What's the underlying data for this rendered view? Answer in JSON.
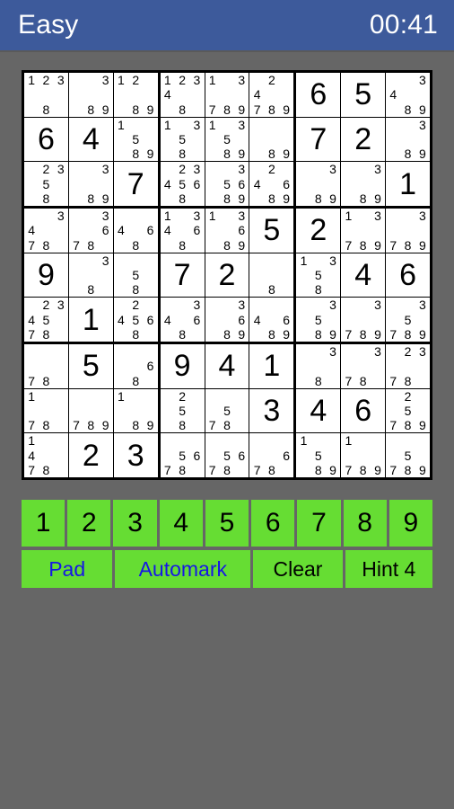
{
  "header": {
    "difficulty": "Easy",
    "timer": "00:41",
    "background_color": "#3D5A9B",
    "text_color": "#FFFFFF"
  },
  "theme": {
    "page_background": "#666666",
    "button_green": "#66DD33",
    "button_text_black": "#000000",
    "button_text_blue": "#1616E6",
    "grid_line": "#000000",
    "cell_background": "#FFFFFF"
  },
  "board": {
    "size": 9,
    "cells": [
      [
        {
          "value": null,
          "candidates": [
            1,
            2,
            3,
            8
          ]
        },
        {
          "value": null,
          "candidates": [
            3,
            8,
            9
          ]
        },
        {
          "value": null,
          "candidates": [
            1,
            2,
            8,
            9
          ]
        },
        {
          "value": null,
          "candidates": [
            1,
            2,
            3,
            4,
            8
          ]
        },
        {
          "value": null,
          "candidates": [
            1,
            3,
            7,
            8,
            9
          ]
        },
        {
          "value": null,
          "candidates": [
            2,
            4,
            7,
            8,
            9
          ]
        },
        {
          "value": 6,
          "candidates": []
        },
        {
          "value": 5,
          "candidates": []
        },
        {
          "value": null,
          "candidates": [
            3,
            4,
            8,
            9
          ]
        }
      ],
      [
        {
          "value": 6,
          "candidates": []
        },
        {
          "value": 4,
          "candidates": []
        },
        {
          "value": null,
          "candidates": [
            1,
            5,
            8,
            9
          ]
        },
        {
          "value": null,
          "candidates": [
            1,
            3,
            5,
            8
          ]
        },
        {
          "value": null,
          "candidates": [
            1,
            3,
            5,
            8,
            9
          ]
        },
        {
          "value": null,
          "candidates": [
            8,
            9
          ]
        },
        {
          "value": 7,
          "candidates": []
        },
        {
          "value": 2,
          "candidates": []
        },
        {
          "value": null,
          "candidates": [
            3,
            8,
            9
          ]
        }
      ],
      [
        {
          "value": null,
          "candidates": [
            2,
            3,
            5,
            8
          ]
        },
        {
          "value": null,
          "candidates": [
            3,
            8,
            9
          ]
        },
        {
          "value": 7,
          "candidates": []
        },
        {
          "value": null,
          "candidates": [
            2,
            3,
            4,
            5,
            6,
            8
          ]
        },
        {
          "value": null,
          "candidates": [
            3,
            5,
            6,
            8,
            9
          ]
        },
        {
          "value": null,
          "candidates": [
            2,
            4,
            6,
            8,
            9
          ]
        },
        {
          "value": null,
          "candidates": [
            3,
            8,
            9
          ]
        },
        {
          "value": null,
          "candidates": [
            3,
            8,
            9
          ]
        },
        {
          "value": 1,
          "candidates": []
        }
      ],
      [
        {
          "value": null,
          "candidates": [
            3,
            4,
            7,
            8
          ]
        },
        {
          "value": null,
          "candidates": [
            3,
            6,
            7,
            8
          ]
        },
        {
          "value": null,
          "candidates": [
            4,
            6,
            8
          ]
        },
        {
          "value": null,
          "candidates": [
            1,
            3,
            4,
            6,
            8
          ]
        },
        {
          "value": null,
          "candidates": [
            1,
            3,
            6,
            8,
            9
          ]
        },
        {
          "value": 5,
          "candidates": []
        },
        {
          "value": 2,
          "candidates": []
        },
        {
          "value": null,
          "candidates": [
            1,
            3,
            7,
            8,
            9
          ]
        },
        {
          "value": null,
          "candidates": [
            3,
            7,
            8,
            9
          ]
        }
      ],
      [
        {
          "value": 9,
          "candidates": []
        },
        {
          "value": null,
          "candidates": [
            3,
            8
          ]
        },
        {
          "value": null,
          "candidates": [
            5,
            8
          ]
        },
        {
          "value": 7,
          "candidates": []
        },
        {
          "value": 2,
          "candidates": []
        },
        {
          "value": null,
          "candidates": [
            8
          ]
        },
        {
          "value": null,
          "candidates": [
            1,
            3,
            5,
            8
          ]
        },
        {
          "value": 4,
          "candidates": []
        },
        {
          "value": 6,
          "candidates": []
        }
      ],
      [
        {
          "value": null,
          "candidates": [
            2,
            3,
            4,
            5,
            7,
            8
          ]
        },
        {
          "value": 1,
          "candidates": []
        },
        {
          "value": null,
          "candidates": [
            2,
            4,
            5,
            6,
            8
          ]
        },
        {
          "value": null,
          "candidates": [
            3,
            4,
            6,
            8
          ]
        },
        {
          "value": null,
          "candidates": [
            3,
            6,
            8,
            9
          ]
        },
        {
          "value": null,
          "candidates": [
            4,
            6,
            8,
            9
          ]
        },
        {
          "value": null,
          "candidates": [
            3,
            5,
            8,
            9
          ]
        },
        {
          "value": null,
          "candidates": [
            3,
            7,
            8,
            9
          ]
        },
        {
          "value": null,
          "candidates": [
            3,
            5,
            7,
            8,
            9
          ]
        }
      ],
      [
        {
          "value": null,
          "candidates": [
            7,
            8
          ]
        },
        {
          "value": 5,
          "candidates": []
        },
        {
          "value": null,
          "candidates": [
            6,
            8
          ]
        },
        {
          "value": 9,
          "candidates": []
        },
        {
          "value": 4,
          "candidates": []
        },
        {
          "value": 1,
          "candidates": []
        },
        {
          "value": null,
          "candidates": [
            3,
            8
          ]
        },
        {
          "value": null,
          "candidates": [
            3,
            7,
            8
          ]
        },
        {
          "value": null,
          "candidates": [
            2,
            3,
            7,
            8
          ]
        }
      ],
      [
        {
          "value": null,
          "candidates": [
            1,
            7,
            8
          ]
        },
        {
          "value": null,
          "candidates": [
            7,
            8,
            9
          ]
        },
        {
          "value": null,
          "candidates": [
            1,
            8,
            9
          ]
        },
        {
          "value": null,
          "candidates": [
            2,
            5,
            8
          ]
        },
        {
          "value": null,
          "candidates": [
            5,
            7,
            8
          ]
        },
        {
          "value": 3,
          "candidates": []
        },
        {
          "value": 4,
          "candidates": []
        },
        {
          "value": 6,
          "candidates": []
        },
        {
          "value": null,
          "candidates": [
            2,
            5,
            7,
            8,
            9
          ]
        }
      ],
      [
        {
          "value": null,
          "candidates": [
            1,
            4,
            7,
            8
          ]
        },
        {
          "value": 2,
          "candidates": []
        },
        {
          "value": 3,
          "candidates": []
        },
        {
          "value": null,
          "candidates": [
            5,
            6,
            7,
            8
          ]
        },
        {
          "value": null,
          "candidates": [
            5,
            6,
            7,
            8
          ]
        },
        {
          "value": null,
          "candidates": [
            6,
            7,
            8
          ]
        },
        {
          "value": null,
          "candidates": [
            1,
            5,
            8,
            9
          ]
        },
        {
          "value": null,
          "candidates": [
            1,
            7,
            8,
            9
          ]
        },
        {
          "value": null,
          "candidates": [
            5,
            7,
            8,
            9
          ]
        }
      ]
    ]
  },
  "number_pad": {
    "buttons": [
      "1",
      "2",
      "3",
      "4",
      "5",
      "6",
      "7",
      "8",
      "9"
    ]
  },
  "action_bar": {
    "buttons": [
      {
        "label": "Pad",
        "style": "blue"
      },
      {
        "label": "Automark",
        "style": "blue"
      },
      {
        "label": "Clear",
        "style": "black"
      },
      {
        "label": "Hint 4",
        "style": "black"
      }
    ]
  }
}
